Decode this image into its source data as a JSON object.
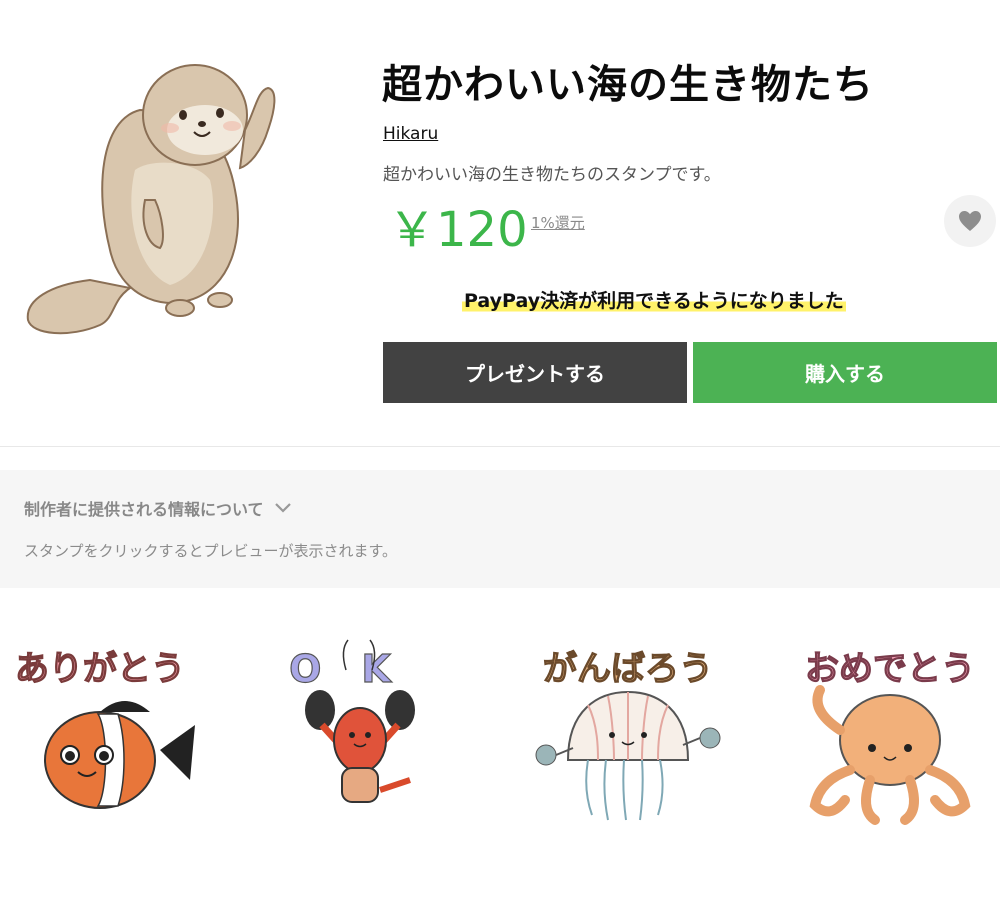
{
  "product": {
    "title": "超かわいい海の生き物たち",
    "author": "Hikaru",
    "description": "超かわいい海の生き物たちのスタンプです。",
    "price": "￥120",
    "cashback": "1%還元",
    "price_color": "#3cb64a"
  },
  "notice": {
    "paypay": "PayPay決済が利用できるようになりました"
  },
  "buttons": {
    "present": "プレゼントする",
    "buy": "購入する",
    "present_color": "#424242",
    "buy_color": "#4cb254"
  },
  "info": {
    "creator_info": "制作者に提供される情報について",
    "preview_hint": "スタンプをクリックするとプレビューが表示されます。"
  },
  "stickers": [
    {
      "caption": "ありがとう",
      "icon": "clownfish"
    },
    {
      "caption": "OK",
      "icon": "lobster"
    },
    {
      "caption": "がんばろう",
      "icon": "jellyfish"
    },
    {
      "caption": "おめでとう",
      "icon": "octopus"
    }
  ],
  "icons": {
    "favorite": "heart-icon",
    "expand": "chevron-down-icon"
  }
}
